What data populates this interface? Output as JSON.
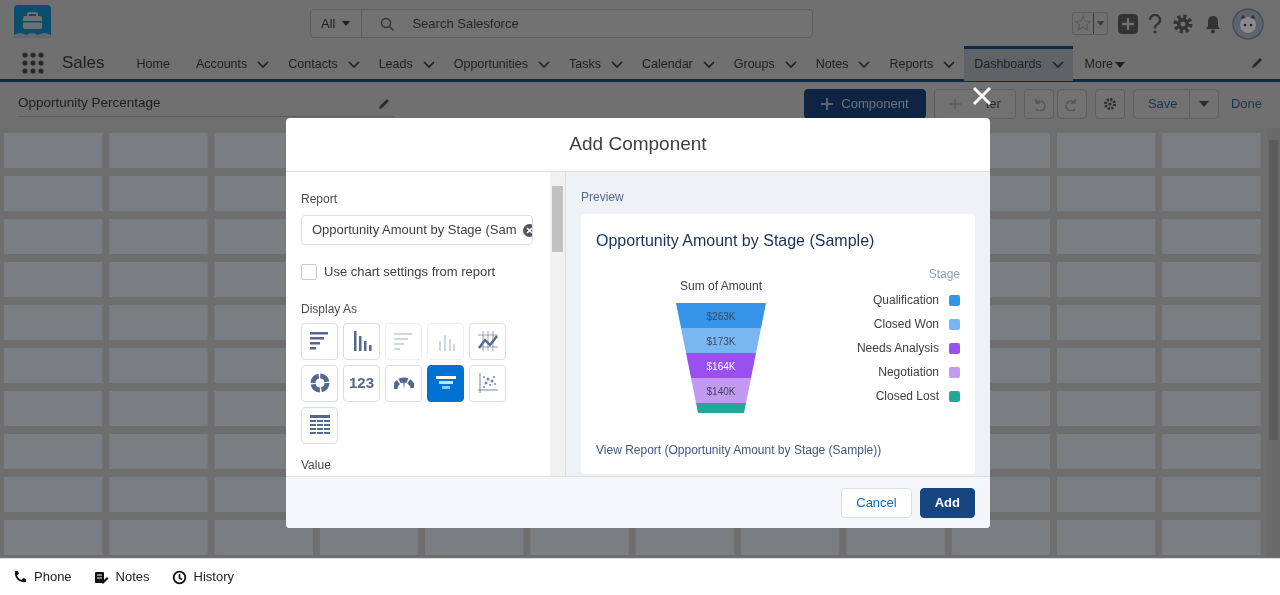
{
  "app": {
    "name": "Sales"
  },
  "search": {
    "scope": "All",
    "placeholder": "Search Salesforce"
  },
  "nav": [
    {
      "label": "Home",
      "kind": "tab",
      "dropdown": false,
      "selected": false
    },
    {
      "label": "Accounts",
      "kind": "tab",
      "dropdown": true,
      "selected": false
    },
    {
      "label": "Contacts",
      "kind": "tab",
      "dropdown": true,
      "selected": false
    },
    {
      "label": "Leads",
      "kind": "tab",
      "dropdown": true,
      "selected": false
    },
    {
      "label": "Opportunities",
      "kind": "tab",
      "dropdown": true,
      "selected": false
    },
    {
      "label": "Tasks",
      "kind": "tab",
      "dropdown": true,
      "selected": false
    },
    {
      "label": "Calendar",
      "kind": "tab",
      "dropdown": true,
      "selected": false
    },
    {
      "label": "Groups",
      "kind": "tab",
      "dropdown": true,
      "selected": false
    },
    {
      "label": "Notes",
      "kind": "tab",
      "dropdown": true,
      "selected": false
    },
    {
      "label": "Reports",
      "kind": "tab",
      "dropdown": true,
      "selected": false
    },
    {
      "label": "Dashboards",
      "kind": "tab",
      "dropdown": true,
      "selected": true
    },
    {
      "label": "More",
      "kind": "overflow",
      "dropdown": true,
      "selected": false
    }
  ],
  "toolbar": {
    "dashboard_name": "Opportunity Percentage",
    "component_button": "Component",
    "filter_button": "ter",
    "save_button": "Save",
    "done_button": "Done"
  },
  "modal": {
    "title": "Add Component",
    "report_label": "Report",
    "report_value": "Opportunity Amount by Stage (Sam",
    "use_chart_settings": {
      "label": "Use chart settings from report",
      "checked": false
    },
    "display_as_label": "Display As",
    "display_options": [
      {
        "kind": "hbar",
        "selected": false,
        "disabled": false
      },
      {
        "kind": "vbar",
        "selected": false,
        "disabled": false
      },
      {
        "kind": "hbar-stacked",
        "selected": false,
        "disabled": true
      },
      {
        "kind": "vbar-stacked",
        "selected": false,
        "disabled": true
      },
      {
        "kind": "line",
        "selected": false,
        "disabled": false
      },
      {
        "kind": "donut",
        "selected": false,
        "disabled": false
      },
      {
        "kind": "metric",
        "label": "123",
        "selected": false,
        "disabled": false
      },
      {
        "kind": "gauge",
        "selected": false,
        "disabled": false
      },
      {
        "kind": "funnel",
        "selected": true,
        "disabled": false
      },
      {
        "kind": "scatter",
        "selected": false,
        "disabled": false
      },
      {
        "kind": "table",
        "selected": false,
        "disabled": false
      }
    ],
    "value_label": "Value",
    "preview": {
      "label": "Preview",
      "title": "Opportunity Amount by Stage (Sample)",
      "funnel": {
        "title": "Sum of Amount",
        "segments": [
          {
            "label": "$263K",
            "color": "#3593e8"
          },
          {
            "label": "$173K",
            "color": "#78b7f2"
          },
          {
            "label": "$164K",
            "color": "#9a4ff0"
          },
          {
            "label": "$140K",
            "color": "#c29af2"
          },
          {
            "color": "#22a89a"
          }
        ]
      },
      "legend_title": "Stage",
      "legend": [
        {
          "label": "Qualification",
          "color": "#3593e8"
        },
        {
          "label": "Closed Won",
          "color": "#78b7f2"
        },
        {
          "label": "Needs Analysis",
          "color": "#9a4ff0"
        },
        {
          "label": "Negotiation",
          "color": "#c29af2"
        },
        {
          "label": "Closed Lost",
          "color": "#22a89a"
        }
      ],
      "link": "View Report (Opportunity Amount by Stage (Sample))"
    },
    "buttons": [
      {
        "label": "Cancel",
        "kind": "neutral"
      },
      {
        "label": "Add",
        "kind": "brand"
      }
    ]
  },
  "utility_bar": [
    {
      "label": "Phone",
      "kind": "phone"
    },
    {
      "label": "Notes",
      "kind": "notes"
    },
    {
      "label": "History",
      "kind": "history"
    }
  ]
}
